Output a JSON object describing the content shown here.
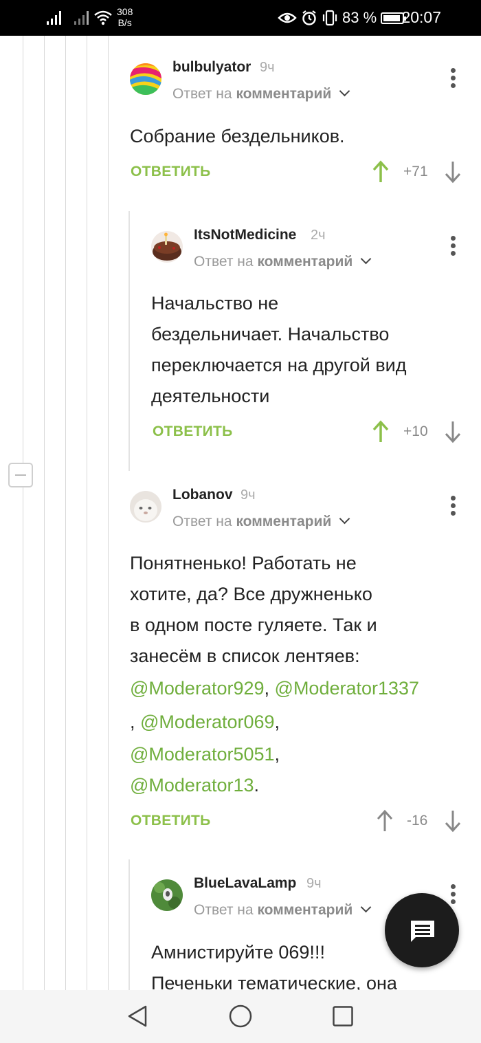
{
  "status_bar": {
    "network_speed_value": "308",
    "network_speed_unit": "B/s",
    "battery_percent": "83 %",
    "time": "20:07",
    "icons": [
      "signal-icon",
      "wifi-icon",
      "eye-icon",
      "alarm-icon",
      "vibrate-icon",
      "battery-icon"
    ]
  },
  "comments": [
    {
      "username": "bulbulyator",
      "time": "9ч",
      "reply_prefix": "Ответ на",
      "reply_target": "комментарий",
      "text": "Собрание бездельников.",
      "reply_label": "ОТВЕТИТЬ",
      "score": "+71",
      "vote_state": "up"
    },
    {
      "username": "ItsNotMedicine",
      "time": "2ч",
      "reply_prefix": "Ответ на",
      "reply_target": "комментарий",
      "text_lines": [
        "Начальство не",
        "бездельничает. Начальство",
        "переключается на другой вид",
        "деятельности"
      ],
      "reply_label": "ОТВЕТИТЬ",
      "score": "+10",
      "vote_state": "up"
    },
    {
      "username": "Lobanov",
      "time": "9ч",
      "reply_prefix": "Ответ на",
      "reply_target": "комментарий",
      "text_lines": [
        "Понятненько! Работать не",
        "хотите, да? Все дружненько",
        "в одном посте гуляете. Так и",
        "занесём в список лентяев:"
      ],
      "mentions": [
        "@Moderator929",
        "@Moderator1337",
        "@Moderator069",
        "@Moderator5051",
        "@Moderator13"
      ],
      "reply_label": "ОТВЕТИТЬ",
      "score": "-16",
      "vote_state": "none"
    },
    {
      "username": "BlueLavaLamp",
      "time": "9ч",
      "reply_prefix": "Ответ на",
      "reply_target": "комментарий",
      "text_lines": [
        "Амнистируйте 069!!!",
        "Печеньки тематические, она"
      ]
    }
  ],
  "colors": {
    "accent_green": "#8cc04a",
    "mention_green": "#6fae3c",
    "upvoted_green": "#8cc04a",
    "neutral_arrow": "#888888"
  },
  "nav": {
    "icons": [
      "back-icon",
      "home-icon",
      "recents-icon"
    ]
  }
}
